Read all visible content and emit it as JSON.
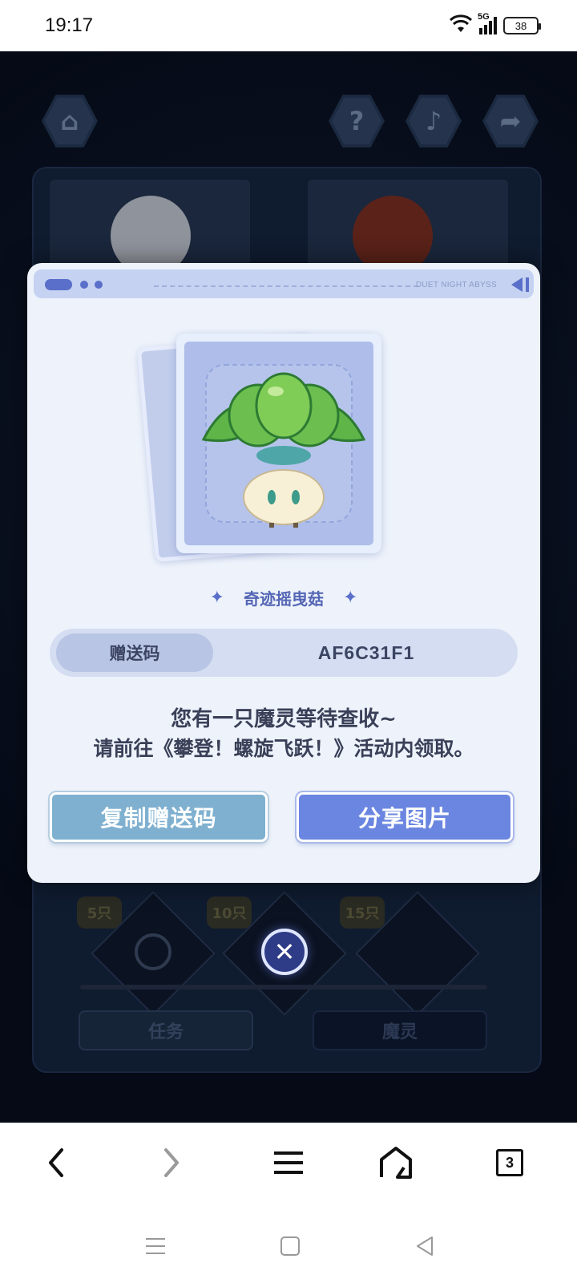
{
  "status_bar": {
    "time": "19:17",
    "network": "5G",
    "battery": "38"
  },
  "background": {
    "home_icon": "home-icon",
    "help_icon": "question-icon",
    "music_icon": "music-icon",
    "share_icon": "share-icon",
    "rewards": [
      "5只",
      "10只",
      "15只"
    ],
    "tabs": [
      "任务",
      "魔灵"
    ]
  },
  "modal": {
    "header_brand": "DUET NIGHT ABYSS",
    "item_name": "奇迹摇曳菇",
    "code_label": "赠送码",
    "code_value": "AF6C31F1",
    "message_line1": "您有一只魔灵等待查收~",
    "message_line2": "请前往《攀登！螺旋飞跃！》活动内领取。",
    "copy_button": "复制赠送码",
    "share_button": "分享图片"
  },
  "browser_nav": {
    "back_icon": "back-icon",
    "forward_icon": "forward-icon",
    "menu_icon": "menu-icon",
    "home_icon": "home-icon",
    "tab_count": "3"
  },
  "colors": {
    "accent": "#6b86e0",
    "copy_button": "#7fb0d0",
    "modal_bg": "#eef3fb"
  }
}
